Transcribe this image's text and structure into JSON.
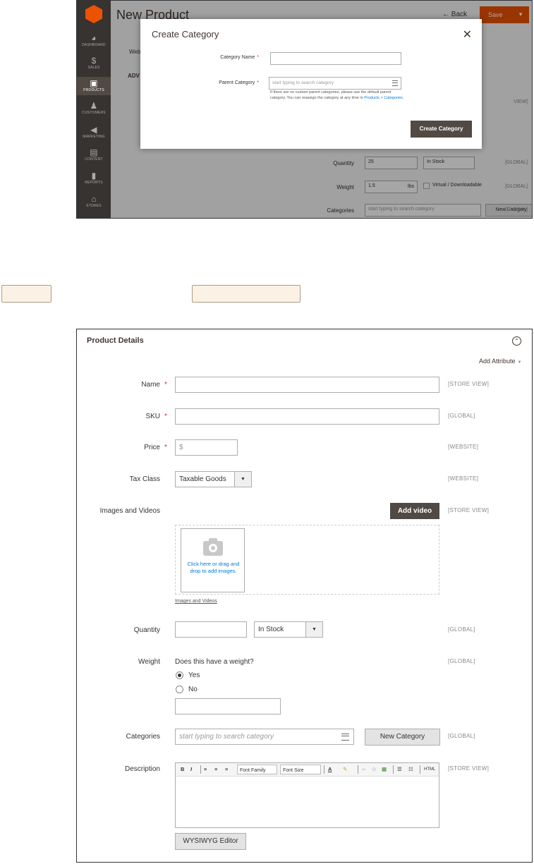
{
  "top_screen": {
    "sidebar": {
      "items": [
        {
          "icon": "dashboard-icon",
          "label": "DASHBOARD",
          "glyph": "◕"
        },
        {
          "icon": "dollar-icon",
          "label": "SALES",
          "glyph": "$"
        },
        {
          "icon": "box-icon",
          "label": "PRODUCTS",
          "glyph": "▣"
        },
        {
          "icon": "person-icon",
          "label": "CUSTOMERS",
          "glyph": "♟"
        },
        {
          "icon": "megaphone-icon",
          "label": "MARKETING",
          "glyph": "◀"
        },
        {
          "icon": "content-icon",
          "label": "CONTENT",
          "glyph": "▤"
        },
        {
          "icon": "bar-chart-icon",
          "label": "REPORTS",
          "glyph": "▮"
        },
        {
          "icon": "store-icon",
          "label": "STORES",
          "glyph": "⌂"
        }
      ]
    },
    "page": {
      "title": "New Product",
      "back_label": "← Back",
      "save_label": "Save",
      "save_arrow": "▼",
      "web_label": "Web",
      "adv_label": "ADV"
    },
    "background_form": {
      "quantity_label": "Quantity",
      "quantity_value": "25",
      "stock_value": "In Stock",
      "weight_label": "Weight",
      "weight_value": "1.5",
      "weight_unit": "lbs",
      "virtual_label": "Virtual / Downloadable",
      "categories_label": "Categories",
      "categories_placeholder": "start typing to search category",
      "new_category_label": "New Category",
      "scope_global": "[GLOBAL]",
      "scope_store_view": "VIEW]"
    },
    "modal": {
      "title": "Create Category",
      "close_glyph": "✕",
      "category_name_label": "Category Name",
      "parent_category_label": "Parent Category",
      "required_mark": "*",
      "parent_placeholder": "start typing to search category",
      "note_before": "If there are no custom parent categories, please use the default parent category. You can reassign the category at any time in",
      "note_link": "Products > Categories",
      "note_after": ".",
      "create_button": "Create Category"
    }
  },
  "product_details": {
    "title": "Product Details",
    "collapse_glyph": "⌃",
    "add_attribute": "Add Attribute",
    "add_attribute_caret": "▼",
    "required_mark": "*",
    "name_label": "Name",
    "name_scope": "[STORE VIEW]",
    "sku_label": "SKU",
    "sku_scope": "[GLOBAL]",
    "price_label": "Price",
    "price_prefix": "$",
    "price_scope": "[WEBSITE]",
    "tax_class_label": "Tax Class",
    "tax_class_value": "Taxable Goods",
    "tax_scope": "[WEBSITE]",
    "images_label": "Images and Videos",
    "add_video": "Add video",
    "images_scope": "[STORE VIEW]",
    "image_drop_text": "Click here or drag and drop to add images.",
    "images_link": "Images and Videos",
    "quantity_label": "Quantity",
    "stock_value": "In Stock",
    "quantity_scope": "[GLOBAL]",
    "weight_label": "Weight",
    "weight_question": "Does this have a weight?",
    "weight_yes": "Yes",
    "weight_no": "No",
    "weight_scope": "[GLOBAL]",
    "weight_selected": "yes",
    "categories_label": "Categories",
    "categories_placeholder": "start typing to search category",
    "new_category": "New Category",
    "categories_scope": "[GLOBAL]",
    "description_label": "Description",
    "description_scope": "[STORE VIEW]",
    "editor_toolbar": {
      "bold": "B",
      "italic": "I",
      "font_family": "Font Family",
      "font_size": "Font Size",
      "text_color": "A",
      "html": "HTML"
    },
    "wysiwyg_button": "WYSIWYG Editor",
    "dropdown_arrow": "▼"
  },
  "colors": {
    "accent_orange": "#eb5202",
    "dark_button": "#514943",
    "link_blue": "#007bdb",
    "required_red": "#e22626",
    "sidebar_bg": "#373330",
    "callout_fill": "#fbf1e5"
  }
}
